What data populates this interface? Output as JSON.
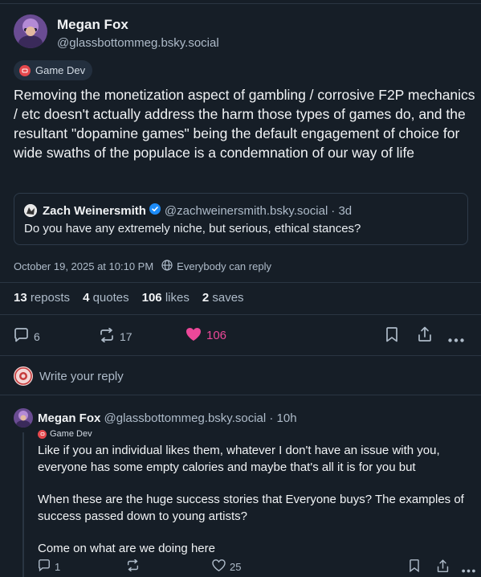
{
  "colors": {
    "background": "#161e27",
    "accent_like": "#ec4899",
    "verified": "#1d8cf8",
    "tag_red": "#e5484d"
  },
  "post": {
    "author_name": "Megan Fox",
    "author_handle": "@glassbottommeg.bsky.social",
    "tag": "Game Dev",
    "text": "Removing the monetization aspect of gambling / corrosive F2P mechanics / etc doesn't actually address the harm those types of games do, and the resultant \"dopamine games\" being the default engagement of choice for wide swaths of the populace is a condemnation of our way of life",
    "quote": {
      "author_name": "Zach Weinersmith",
      "author_handle": "@zachweinersmith.bsky.social",
      "time": "· 3d",
      "text": "Do you have any extremely niche, but serious, ethical stances?"
    },
    "timestamp": "October 19, 2025 at 10:10 PM",
    "reply_setting": "Everybody can reply",
    "stats": {
      "reposts_count": "13",
      "reposts_label": "reposts",
      "quotes_count": "4",
      "quotes_label": "quotes",
      "likes_count": "106",
      "likes_label": "likes",
      "saves_count": "2",
      "saves_label": "saves"
    },
    "actions": {
      "reply_count": "6",
      "repost_count": "17",
      "like_count": "106"
    }
  },
  "reply_prompt": "Write your reply",
  "reply": {
    "author_name": "Megan Fox",
    "author_handle": "@glassbottommeg.bsky.social",
    "time": "· 10h",
    "tag": "Game Dev",
    "paragraphs": [
      "Like if you an individual likes them, whatever I don't have an issue with you, everyone has some empty calories and maybe that's all it is for you but",
      "When these are the huge success stories that Everyone buys? The examples of success passed down to young artists?",
      "Come on what are we doing here"
    ],
    "actions": {
      "reply_count": "1",
      "like_count": "25"
    }
  }
}
